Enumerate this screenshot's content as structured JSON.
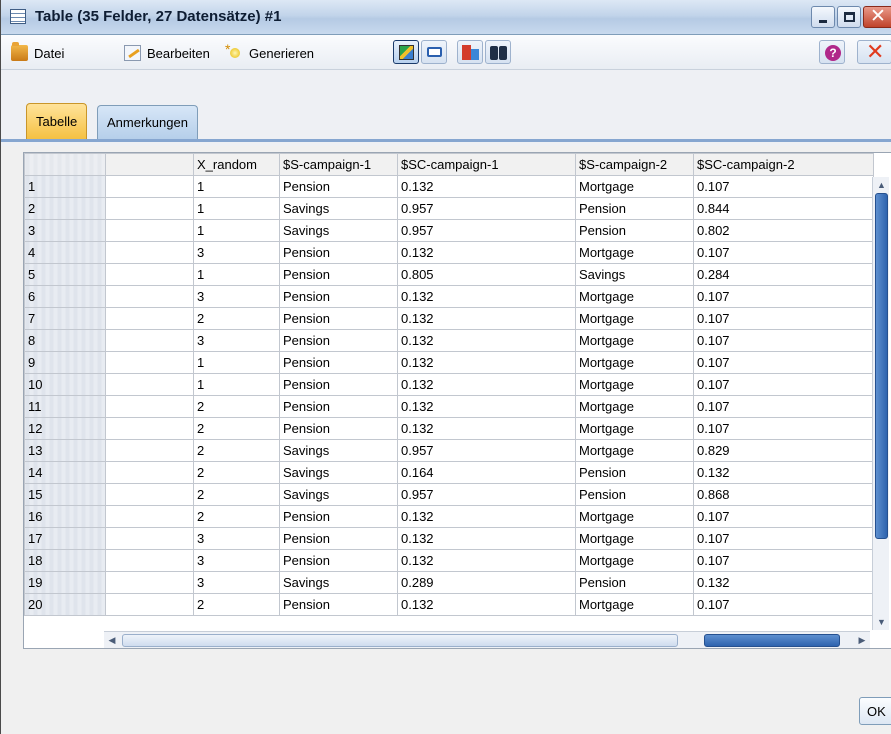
{
  "window": {
    "title": "Table (35 Felder, 27 Datensätze) #1"
  },
  "toolbar": {
    "file_label": "Datei",
    "edit_label": "Bearbeiten",
    "generate_label": "Generieren"
  },
  "tabs": [
    {
      "label": "Tabelle",
      "active": true
    },
    {
      "label": "Anmerkungen",
      "active": false
    }
  ],
  "table": {
    "columns": [
      "",
      "X_random",
      "$S-campaign-1",
      "$SC-campaign-1",
      "$S-campaign-2",
      "$SC-campaign-2"
    ],
    "rows": [
      [
        "1",
        "",
        "1",
        "Pension",
        "0.132",
        "Mortgage",
        "0.107"
      ],
      [
        "2",
        "",
        "1",
        "Savings",
        "0.957",
        "Pension",
        "0.844"
      ],
      [
        "3",
        "",
        "1",
        "Savings",
        "0.957",
        "Pension",
        "0.802"
      ],
      [
        "4",
        "",
        "3",
        "Pension",
        "0.132",
        "Mortgage",
        "0.107"
      ],
      [
        "5",
        "",
        "1",
        "Pension",
        "0.805",
        "Savings",
        "0.284"
      ],
      [
        "6",
        "",
        "3",
        "Pension",
        "0.132",
        "Mortgage",
        "0.107"
      ],
      [
        "7",
        "",
        "2",
        "Pension",
        "0.132",
        "Mortgage",
        "0.107"
      ],
      [
        "8",
        "",
        "3",
        "Pension",
        "0.132",
        "Mortgage",
        "0.107"
      ],
      [
        "9",
        "",
        "1",
        "Pension",
        "0.132",
        "Mortgage",
        "0.107"
      ],
      [
        "10",
        "",
        "1",
        "Pension",
        "0.132",
        "Mortgage",
        "0.107"
      ],
      [
        "11",
        "",
        "2",
        "Pension",
        "0.132",
        "Mortgage",
        "0.107"
      ],
      [
        "12",
        "",
        "2",
        "Pension",
        "0.132",
        "Mortgage",
        "0.107"
      ],
      [
        "13",
        "",
        "2",
        "Savings",
        "0.957",
        "Mortgage",
        "0.829"
      ],
      [
        "14",
        "",
        "2",
        "Savings",
        "0.164",
        "Pension",
        "0.132"
      ],
      [
        "15",
        "",
        "2",
        "Savings",
        "0.957",
        "Pension",
        "0.868"
      ],
      [
        "16",
        "",
        "2",
        "Pension",
        "0.132",
        "Mortgage",
        "0.107"
      ],
      [
        "17",
        "",
        "3",
        "Pension",
        "0.132",
        "Mortgage",
        "0.107"
      ],
      [
        "18",
        "",
        "3",
        "Pension",
        "0.132",
        "Mortgage",
        "0.107"
      ],
      [
        "19",
        "",
        "3",
        "Savings",
        "0.289",
        "Pension",
        "0.132"
      ],
      [
        "20",
        "",
        "2",
        "Pension",
        "0.132",
        "Mortgage",
        "0.107"
      ]
    ]
  },
  "buttons": {
    "ok_label": "OK"
  },
  "icons": {
    "file": "folder-icon",
    "edit": "edit-icon",
    "generate": "generate-icon",
    "select": "grid-select-icon",
    "print": "print-icon",
    "mark": "mark-icon",
    "find": "binoculars-icon",
    "help": "help-icon",
    "close": "close-icon"
  },
  "colors": {
    "tab_active": "#f5c142",
    "tab_inactive": "#b6cfea",
    "scroll_thumb": "#2e63ae",
    "close_red": "#e03a1e"
  }
}
